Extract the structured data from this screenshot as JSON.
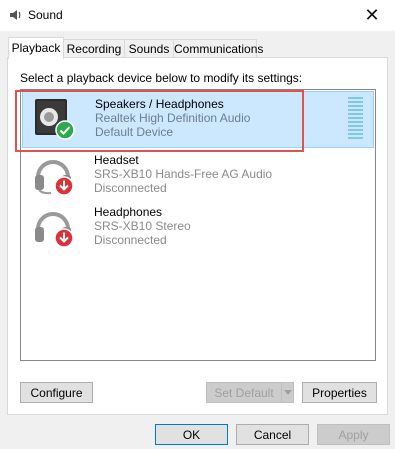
{
  "window": {
    "title": "Sound",
    "close_glyph": "✕"
  },
  "tabs": [
    {
      "label": "Playback",
      "active": true
    },
    {
      "label": "Recording",
      "active": false
    },
    {
      "label": "Sounds",
      "active": false
    },
    {
      "label": "Communications",
      "active": false
    }
  ],
  "instruction": "Select a playback device below to modify its settings:",
  "devices": [
    {
      "name": "Speakers / Headphones",
      "driver": "Realtek High Definition Audio",
      "status": "Default Device",
      "icon": "speaker-icon",
      "badge": "green-check-icon",
      "selected": true
    },
    {
      "name": "Headset",
      "driver": "SRS-XB10 Hands-Free AG Audio",
      "status": "Disconnected",
      "icon": "headset-icon",
      "badge": "red-down-arrow-icon",
      "selected": false
    },
    {
      "name": "Headphones",
      "driver": "SRS-XB10 Stereo",
      "status": "Disconnected",
      "icon": "headphones-icon",
      "badge": "red-down-arrow-icon",
      "selected": false
    }
  ],
  "buttons": {
    "configure": "Configure",
    "set_default": "Set Default",
    "properties": "Properties",
    "ok": "OK",
    "cancel": "Cancel",
    "apply": "Apply"
  },
  "colors": {
    "selection_bg": "#cce8ff",
    "highlight_border": "#e05151",
    "level_meter": "#7fc9e8"
  }
}
